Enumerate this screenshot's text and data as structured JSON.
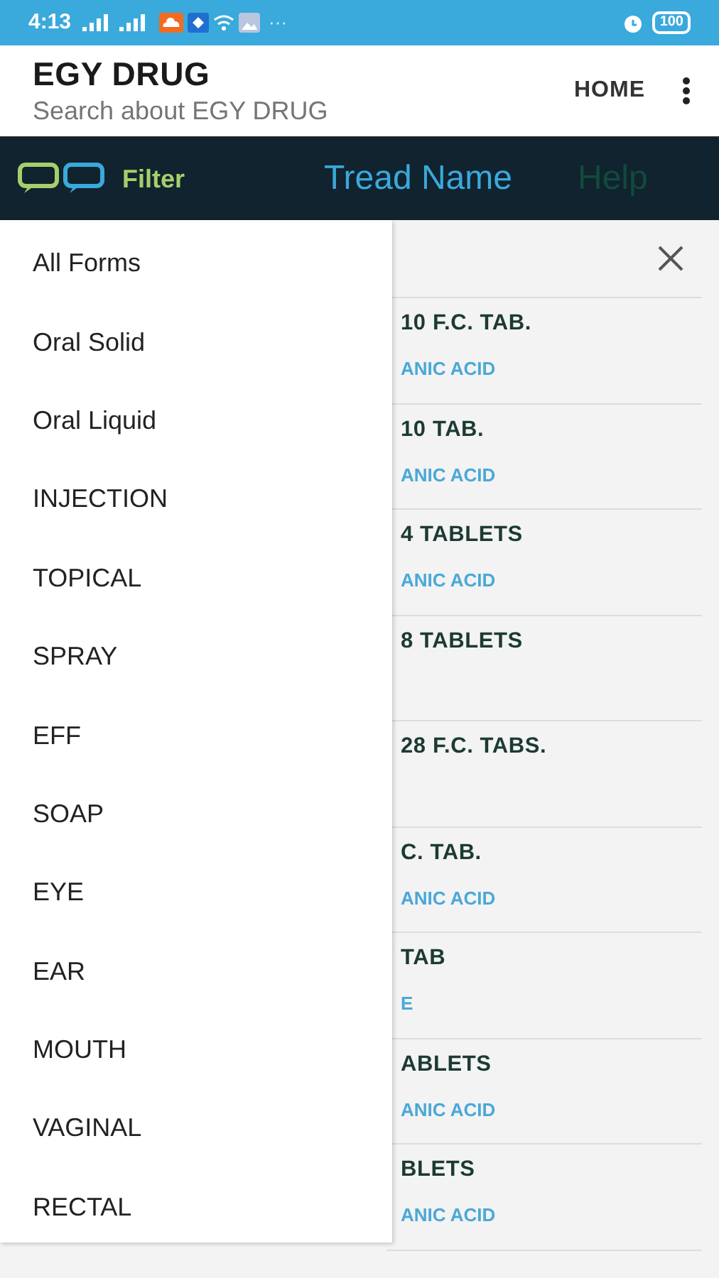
{
  "status_bar": {
    "time": "4:13",
    "more": "···",
    "battery": "100"
  },
  "app_bar": {
    "title": "EGY DRUG",
    "subtitle": "Search about EGY DRUG",
    "action": "HOME"
  },
  "nav": {
    "filter": "Filter",
    "tabs": [
      {
        "label": "Tread Name",
        "selected": true
      },
      {
        "label": "Help",
        "selected": false
      }
    ]
  },
  "results": [
    {
      "name": "10 F.C. TAB.",
      "ingredient": "ANIC ACID"
    },
    {
      "name": "10 TAB.",
      "ingredient": "ANIC ACID"
    },
    {
      "name": "4 TABLETS",
      "ingredient": "ANIC ACID"
    },
    {
      "name": "8 TABLETS"
    },
    {
      "name": "28 F.C. TABS."
    },
    {
      "name": "C. TAB.",
      "ingredient": "ANIC ACID"
    },
    {
      "name": "TAB",
      "ingredient": "E"
    },
    {
      "name": "ABLETS",
      "ingredient": "ANIC ACID"
    },
    {
      "name": "BLETS",
      "ingredient": "ANIC ACID"
    }
  ],
  "form_menu": {
    "items": [
      "All Forms",
      "Oral Solid",
      "Oral Liquid",
      "INJECTION",
      "TOPICAL",
      "SPRAY",
      "EFF",
      "SOAP",
      "EYE",
      "EAR",
      "MOUTH",
      "VAGINAL",
      "RECTAL"
    ]
  }
}
